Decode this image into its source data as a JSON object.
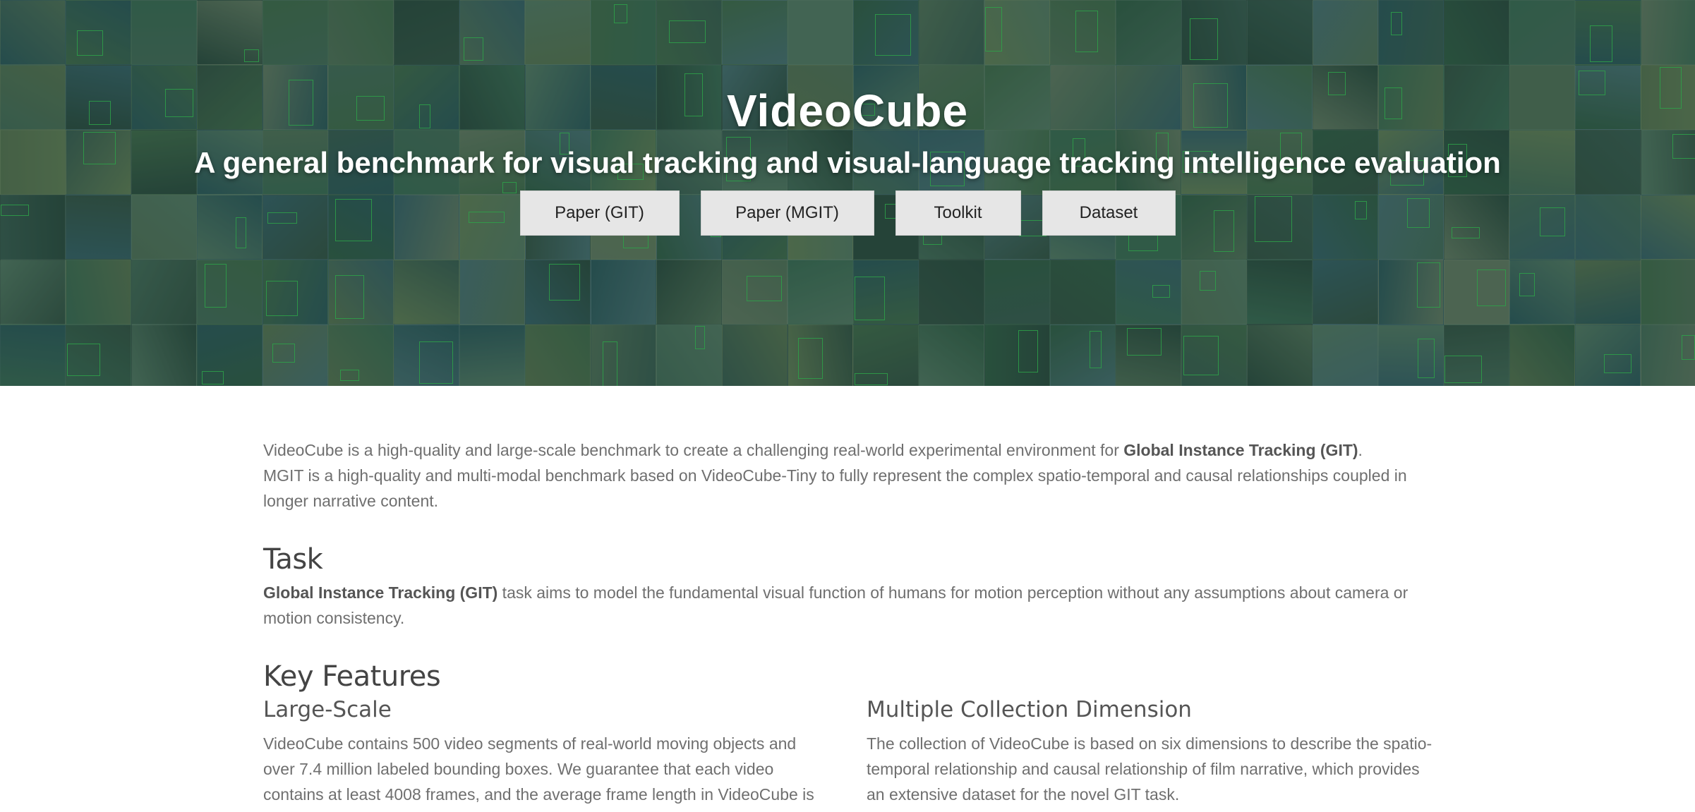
{
  "hero": {
    "title": "VideoCube",
    "subtitle": "A general benchmark for visual tracking and visual-language tracking intelligence evaluation",
    "buttons": [
      {
        "label": "Paper (GIT)"
      },
      {
        "label": "Paper (MGIT)"
      },
      {
        "label": "Toolkit"
      },
      {
        "label": "Dataset"
      }
    ]
  },
  "intro": {
    "line1_prefix": "VideoCube is a high-quality and large-scale benchmark to create a challenging real-world experimental environment for ",
    "line1_bold": "Global Instance Tracking (GIT)",
    "line1_suffix": ".",
    "line2": "MGIT is a high-quality and multi-modal benchmark based on VideoCube-Tiny to fully represent the complex spatio-temporal and causal relationships coupled in longer narrative content."
  },
  "task": {
    "heading": "Task",
    "bold": "Global Instance Tracking (GIT)",
    "text": " task aims to model the fundamental visual function of humans for motion perception without any assumptions about camera or motion consistency."
  },
  "features": {
    "heading": "Key Features",
    "items": [
      {
        "title": "Large-Scale",
        "text": "VideoCube contains 500 video segments of real-world moving objects and over 7.4 million labeled bounding boxes. We guarantee that each video contains at least 4008 frames, and the average frame length in VideoCube is"
      },
      {
        "title": "Multiple Collection Dimension",
        "text": "The collection of VideoCube is based on six dimensions to describe the spatio-temporal relationship and causal relationship of film narrative, which provides an extensive dataset for the novel GIT task."
      }
    ]
  },
  "colors": {
    "hero_overlay": "#2f4a46",
    "bbox_green": "#3cd85a",
    "button_bg": "#e6e6e6",
    "body_text": "#6f6f6f"
  }
}
